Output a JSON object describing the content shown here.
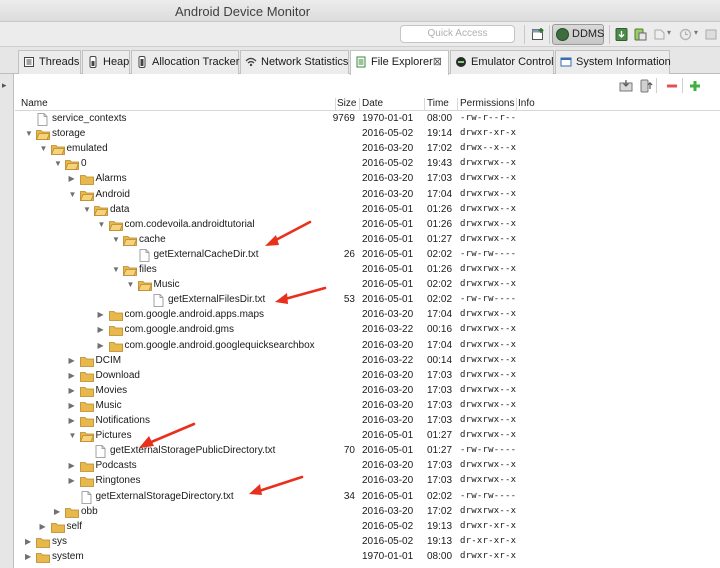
{
  "window": {
    "title": "Android Device Monitor"
  },
  "toolbar": {
    "quick_access_placeholder": "Quick Access",
    "perspective_label": "DDMS"
  },
  "tabs": [
    {
      "label": "Threads",
      "icon": "threads-icon",
      "active": false
    },
    {
      "label": "Heap",
      "icon": "heap-icon",
      "active": false
    },
    {
      "label": "Allocation Tracker",
      "icon": "allocation-icon",
      "active": false
    },
    {
      "label": "Network Statistics",
      "icon": "network-icon",
      "active": false
    },
    {
      "label": "File Explorer",
      "icon": "file-explorer-icon",
      "active": true,
      "close": "⊠"
    },
    {
      "label": "Emulator Control",
      "icon": "emulator-icon",
      "active": false
    },
    {
      "label": "System Information",
      "icon": "system-info-icon",
      "active": false
    }
  ],
  "columns": {
    "name": "Name",
    "size": "Size",
    "date": "Date",
    "time": "Time",
    "permissions": "Permissions",
    "info": "Info"
  },
  "rows": [
    {
      "name": "service_contexts",
      "depth": 0,
      "type": "file",
      "expanded": null,
      "size": "9769",
      "date": "1970-01-01",
      "time": "08:00",
      "perm": "-rw-r--r--"
    },
    {
      "name": "storage",
      "depth": 0,
      "type": "folder",
      "expanded": true,
      "size": "",
      "date": "2016-05-02",
      "time": "19:14",
      "perm": "drwxr-xr-x"
    },
    {
      "name": "emulated",
      "depth": 1,
      "type": "folder",
      "expanded": true,
      "size": "",
      "date": "2016-03-20",
      "time": "17:02",
      "perm": "drwx--x--x"
    },
    {
      "name": "0",
      "depth": 2,
      "type": "folder",
      "expanded": true,
      "size": "",
      "date": "2016-05-02",
      "time": "19:43",
      "perm": "drwxrwx--x"
    },
    {
      "name": "Alarms",
      "depth": 3,
      "type": "folder",
      "expanded": false,
      "size": "",
      "date": "2016-03-20",
      "time": "17:03",
      "perm": "drwxrwx--x"
    },
    {
      "name": "Android",
      "depth": 3,
      "type": "folder",
      "expanded": true,
      "size": "",
      "date": "2016-03-20",
      "time": "17:04",
      "perm": "drwxrwx--x"
    },
    {
      "name": "data",
      "depth": 4,
      "type": "folder",
      "expanded": true,
      "size": "",
      "date": "2016-05-01",
      "time": "01:26",
      "perm": "drwxrwx--x"
    },
    {
      "name": "com.codevoila.androidtutorial",
      "depth": 5,
      "type": "folder",
      "expanded": true,
      "size": "",
      "date": "2016-05-01",
      "time": "01:26",
      "perm": "drwxrwx--x"
    },
    {
      "name": "cache",
      "depth": 6,
      "type": "folder",
      "expanded": true,
      "size": "",
      "date": "2016-05-01",
      "time": "01:27",
      "perm": "drwxrwx--x"
    },
    {
      "name": "getExternalCacheDir.txt",
      "depth": 7,
      "type": "file",
      "expanded": null,
      "size": "26",
      "date": "2016-05-01",
      "time": "02:02",
      "perm": "-rw-rw----"
    },
    {
      "name": "files",
      "depth": 6,
      "type": "folder",
      "expanded": true,
      "size": "",
      "date": "2016-05-01",
      "time": "01:26",
      "perm": "drwxrwx--x"
    },
    {
      "name": "Music",
      "depth": 7,
      "type": "folder",
      "expanded": true,
      "size": "",
      "date": "2016-05-01",
      "time": "02:02",
      "perm": "drwxrwx--x"
    },
    {
      "name": "getExternalFilesDir.txt",
      "depth": 8,
      "type": "file",
      "expanded": null,
      "size": "53",
      "date": "2016-05-01",
      "time": "02:02",
      "perm": "-rw-rw----"
    },
    {
      "name": "com.google.android.apps.maps",
      "depth": 5,
      "type": "folder",
      "expanded": false,
      "size": "",
      "date": "2016-03-20",
      "time": "17:04",
      "perm": "drwxrwx--x"
    },
    {
      "name": "com.google.android.gms",
      "depth": 5,
      "type": "folder",
      "expanded": false,
      "size": "",
      "date": "2016-03-22",
      "time": "00:16",
      "perm": "drwxrwx--x"
    },
    {
      "name": "com.google.android.googlequicksearchbox",
      "depth": 5,
      "type": "folder",
      "expanded": false,
      "size": "",
      "date": "2016-03-20",
      "time": "17:04",
      "perm": "drwxrwx--x"
    },
    {
      "name": "DCIM",
      "depth": 3,
      "type": "folder",
      "expanded": false,
      "size": "",
      "date": "2016-03-22",
      "time": "00:14",
      "perm": "drwxrwx--x"
    },
    {
      "name": "Download",
      "depth": 3,
      "type": "folder",
      "expanded": false,
      "size": "",
      "date": "2016-03-20",
      "time": "17:03",
      "perm": "drwxrwx--x"
    },
    {
      "name": "Movies",
      "depth": 3,
      "type": "folder",
      "expanded": false,
      "size": "",
      "date": "2016-03-20",
      "time": "17:03",
      "perm": "drwxrwx--x"
    },
    {
      "name": "Music",
      "depth": 3,
      "type": "folder",
      "expanded": false,
      "size": "",
      "date": "2016-03-20",
      "time": "17:03",
      "perm": "drwxrwx--x"
    },
    {
      "name": "Notifications",
      "depth": 3,
      "type": "folder",
      "expanded": false,
      "size": "",
      "date": "2016-03-20",
      "time": "17:03",
      "perm": "drwxrwx--x"
    },
    {
      "name": "Pictures",
      "depth": 3,
      "type": "folder",
      "expanded": true,
      "size": "",
      "date": "2016-05-01",
      "time": "01:27",
      "perm": "drwxrwx--x"
    },
    {
      "name": "getExternalStoragePublicDirectory.txt",
      "depth": 4,
      "type": "file",
      "expanded": null,
      "size": "70",
      "date": "2016-05-01",
      "time": "01:27",
      "perm": "-rw-rw----"
    },
    {
      "name": "Podcasts",
      "depth": 3,
      "type": "folder",
      "expanded": false,
      "size": "",
      "date": "2016-03-20",
      "time": "17:03",
      "perm": "drwxrwx--x"
    },
    {
      "name": "Ringtones",
      "depth": 3,
      "type": "folder",
      "expanded": false,
      "size": "",
      "date": "2016-03-20",
      "time": "17:03",
      "perm": "drwxrwx--x"
    },
    {
      "name": "getExternalStorageDirectory.txt",
      "depth": 3,
      "type": "file",
      "expanded": null,
      "size": "34",
      "date": "2016-05-01",
      "time": "02:02",
      "perm": "-rw-rw----"
    },
    {
      "name": "obb",
      "depth": 2,
      "type": "folder",
      "expanded": false,
      "size": "",
      "date": "2016-03-20",
      "time": "17:02",
      "perm": "drwxrwx--x"
    },
    {
      "name": "self",
      "depth": 1,
      "type": "folder",
      "expanded": false,
      "size": "",
      "date": "2016-05-02",
      "time": "19:13",
      "perm": "drwxr-xr-x"
    },
    {
      "name": "sys",
      "depth": 0,
      "type": "folder",
      "expanded": false,
      "size": "",
      "date": "2016-05-02",
      "time": "19:13",
      "perm": "dr-xr-xr-x"
    },
    {
      "name": "system",
      "depth": 0,
      "type": "folder",
      "expanded": false,
      "size": "",
      "date": "1970-01-01",
      "time": "08:00",
      "perm": "drwxr-xr-x"
    }
  ],
  "annotations": {
    "arrow_color": "#e8301c"
  },
  "colors": {
    "folder": "#e8b84a",
    "folder_edge": "#b8862a",
    "delete_button": "#e35050",
    "add_button": "#3db03d"
  }
}
